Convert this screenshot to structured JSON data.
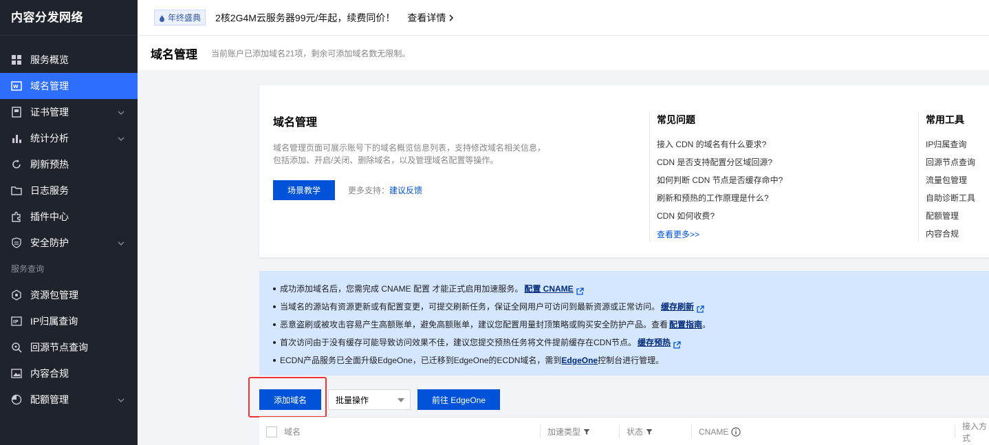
{
  "sidebar": {
    "brand": "内容分发网络",
    "items": [
      {
        "label": "服务概览",
        "icon": "grid-icon",
        "active": false,
        "chevron": false
      },
      {
        "label": "域名管理",
        "icon": "domain-icon",
        "active": true,
        "chevron": false
      },
      {
        "label": "证书管理",
        "icon": "certificate-icon",
        "active": false,
        "chevron": true
      },
      {
        "label": "统计分析",
        "icon": "bar-chart-icon",
        "active": false,
        "chevron": true
      },
      {
        "label": "刷新预热",
        "icon": "refresh-icon",
        "active": false,
        "chevron": false
      },
      {
        "label": "日志服务",
        "icon": "folder-icon",
        "active": false,
        "chevron": false
      },
      {
        "label": "插件中心",
        "icon": "plugin-icon",
        "active": false,
        "chevron": false
      },
      {
        "label": "安全防护",
        "icon": "shield-icon",
        "active": false,
        "chevron": true
      }
    ],
    "section_label": "服务查询",
    "items2": [
      {
        "label": "资源包管理",
        "icon": "package-icon",
        "chevron": false
      },
      {
        "label": "IP归属查询",
        "icon": "ip-icon",
        "chevron": false
      },
      {
        "label": "回源节点查询",
        "icon": "search-node-icon",
        "chevron": false
      },
      {
        "label": "内容合规",
        "icon": "image-icon",
        "chevron": false
      },
      {
        "label": "配额管理",
        "icon": "pie-icon",
        "chevron": true
      }
    ]
  },
  "promo": {
    "tag": "年终盛典",
    "text": "2核2G4M云服务器99元/年起，续费同价！",
    "link": "查看详情"
  },
  "page": {
    "title": "域名管理",
    "subtitle": "当前账户已添加域名21项，剩余可添加域名数无限制。"
  },
  "intro": {
    "title": "域名管理",
    "desc_line1": "域名管理页面可展示账号下的域名概览信息列表，支持修改域名相关信息，",
    "desc_line2": "包括添加、开启/关闭、删除域名，以及管理域名配置等操作。",
    "button": "场景教学",
    "more_prefix": "更多支持：",
    "more_link": "建议反馈",
    "faq_title": "常见问题",
    "faq": [
      "接入 CDN 的域名有什么要求?",
      "CDN 是否支持配置分区域回源?",
      "如何判断 CDN 节点是否缓存命中?",
      "刷新和预热的工作原理是什么?",
      "CDN 如何收费?"
    ],
    "faq_more": "查看更多>>",
    "tools_title": "常用工具",
    "tools": [
      "IP归属查询",
      "回源节点查询",
      "流量包管理",
      "自助诊断工具",
      "配额管理",
      "内容合规"
    ]
  },
  "notice": [
    {
      "text": "成功添加域名后，您需完成 CNAME 配置 才能正式启用加速服务。",
      "link": "配置 CNAME",
      "ext": true,
      "suffix": ""
    },
    {
      "text": "当域名的源站有资源更新或有配置变更，可提交刷新任务，保证全网用户可访问到最新资源或正常访问。",
      "link": "缓存刷新",
      "ext": true,
      "suffix": ""
    },
    {
      "text": "恶意盗刷或被攻击容易产生高额账单，避免高额账单，建议您配置用量封顶策略或购买安全防护产品。查看 ",
      "link": "配置指南",
      "ext": false,
      "suffix": " 。"
    },
    {
      "text": "首次访问由于没有缓存可能导致访问效果不佳，建议您提交预热任务将文件提前缓存在CDN节点。",
      "link": "缓存预热",
      "ext": true,
      "suffix": ""
    },
    {
      "text": "ECDN产品服务已全面升级EdgeOne，已迁移到EdgeOne的ECDN域名，需到",
      "link": "EdgeOne",
      "ext": false,
      "suffix": "控制台进行管理。"
    }
  ],
  "toolbar": {
    "add": "添加域名",
    "batch": "批量操作",
    "edgeone": "前往 EdgeOne"
  },
  "table": {
    "columns": [
      "域名",
      "加速类型",
      "状态",
      "CNAME",
      "接入方式"
    ]
  }
}
